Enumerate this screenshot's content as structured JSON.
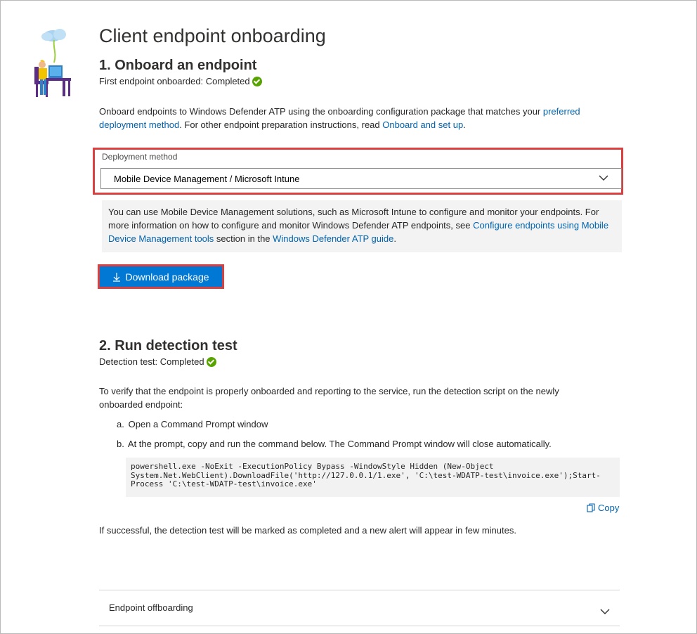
{
  "page": {
    "title": "Client endpoint onboarding"
  },
  "section1": {
    "title": "1. Onboard an endpoint",
    "status_label": "First endpoint onboarded: Completed",
    "intro_text_1": "Onboard endpoints to Windows Defender ATP using the onboarding configuration package that matches your ",
    "intro_link_1": "preferred deployment method",
    "intro_text_2": ". For other endpoint preparation instructions, read ",
    "intro_link_2": "Onboard and set up",
    "intro_text_3": ".",
    "deployment_label": "Deployment method",
    "deployment_value": "Mobile Device Management / Microsoft Intune",
    "info_text_1": "You can use Mobile Device Management solutions, such as Microsoft Intune to configure and monitor your endpoints. For more information on how to configure and monitor Windows Defender ATP endpoints, see ",
    "info_link_1": "Configure endpoints using Mobile Device Management tools",
    "info_text_2": " section in the ",
    "info_link_2": "Windows Defender ATP guide",
    "info_text_3": ".",
    "download_button": "Download package"
  },
  "section2": {
    "title": "2. Run detection test",
    "status_label": "Detection test: Completed",
    "intro_text": "To verify that the endpoint is properly onboarded and reporting to the service, run the detection script on the newly onboarded endpoint:",
    "steps": [
      {
        "marker": "a.",
        "text": "Open a Command Prompt window"
      },
      {
        "marker": "b.",
        "text": "At the prompt, copy and run the command below. The Command Prompt window will close automatically."
      }
    ],
    "command": "powershell.exe -NoExit -ExecutionPolicy Bypass -WindowStyle Hidden (New-Object\nSystem.Net.WebClient).DownloadFile('http://127.0.0.1/1.exe', 'C:\\test-WDATP-test\\invoice.exe');Start-\nProcess 'C:\\test-WDATP-test\\invoice.exe'",
    "copy_label": "Copy",
    "success_text": "If successful, the detection test will be marked as completed and a new alert will appear in few minutes."
  },
  "offboarding": {
    "label": "Endpoint offboarding"
  },
  "colors": {
    "accent": "#0078d4",
    "link": "#0062ad",
    "highlight": "#d9403f",
    "success": "#57a300"
  },
  "icons": {
    "status": "check-circle-icon",
    "download": "download-icon",
    "dropdown": "chevron-down-icon",
    "copy": "copy-icon"
  }
}
